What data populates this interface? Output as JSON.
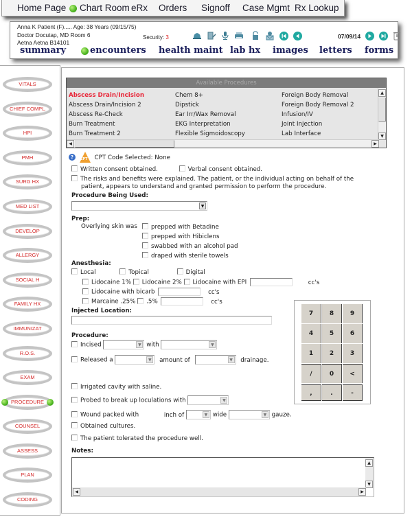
{
  "topnav": {
    "items": [
      "Home Page",
      "Chart Room",
      "eRx",
      "Orders",
      "Signoff",
      "Case Mgmt",
      "Rx Lookup"
    ]
  },
  "patient": {
    "line1": "Anna K Patient (F)..... Age: 38 Years (09/15/75)",
    "line2": "Doctor Docutap, MD  Room 6",
    "line3": "Aetna Aetna B14101",
    "security_label": "Security:",
    "security_value": "3",
    "date": "07/09/14"
  },
  "header_icons": [
    "hardhat-icon",
    "document-edit-icon",
    "microphone-icon",
    "printer-icon",
    "lock-icon",
    "mail-person-icon",
    "first-record-icon",
    "previous-record-icon",
    "next-record-icon",
    "last-record-icon",
    "trash-icon"
  ],
  "tabs": [
    "summary",
    "encounters",
    "health maint",
    "lab hx",
    "images",
    "letters",
    "forms"
  ],
  "sidebar": {
    "items": [
      "VITALS",
      "CHIEF COMPLAINT",
      "HPI",
      "PMH",
      "SURG HX",
      "MED LIST",
      "DEVELOP",
      "ALLERGY",
      "SOCIAL H",
      "FAMILY HX",
      "IMMUNIZAT",
      "R.O.S.",
      "EXAM",
      "PROCEDURE",
      "COUNSEL",
      "ASSESS",
      "PLAN",
      "CODING"
    ],
    "active": "PROCEDURE"
  },
  "procedures": {
    "title": "Available Procedures",
    "columns": [
      [
        "Abscess Drain/Incision",
        "Abscess Drain/Incision 2",
        "Abscess Re-Check",
        "Burn Treatment",
        "Burn Treatment 2"
      ],
      [
        "Chem 8+",
        "Dipstick",
        "Ear Irr/Wax Removal",
        "EKG Interpretation",
        "Flexible Sigmoidoscopy"
      ],
      [
        "Foreign Body Removal",
        "Foreign Body Removal 2",
        "Infusion/IV",
        "Joint Injection",
        "Lab Interface"
      ]
    ],
    "selected": "Abscess Drain/Incision"
  },
  "form": {
    "cpt_badge": "CPT",
    "cpt_selected": "CPT Code Selected: None",
    "written_consent": "Written consent obtained.",
    "verbal_consent": "Verbal consent obtained.",
    "risks_line1": "The risks and benefits were explained. The patient, or the individual acting on behalf of the",
    "risks_line2": "patient, appears to understand and granted permission to perform the procedure.",
    "procedure_used_label": "Procedure Being Used:",
    "procedure_used_value": "",
    "prep_label": "Prep:",
    "overlying": "Overlying skin was",
    "prep_options": [
      "prepped with Betadine",
      "prepped with Hibiclens",
      "swabbed with an alcohol pad",
      "draped with sterile towels"
    ],
    "anesthesia_label": "Anesthesia:",
    "anesthesia_types": [
      "Local",
      "Topical",
      "Digital"
    ],
    "lido1": "Lidocaine 1%",
    "lido2": "Lidocaine 2%",
    "lido_epi": "Lidocaine with EPI",
    "lido_bicarb": "Lidocaine with bicarb",
    "marcaine": "Marcaine .25%",
    "marcaine5": ".5%",
    "ccs": "cc's",
    "injected_label": "Injected Location:",
    "injected_value": "",
    "procedure_label": "Procedure:",
    "incised": "Incised",
    "with": "with",
    "released": "Released a",
    "amount_of": "amount of",
    "drainage": "drainage.",
    "irrigated": "Irrigated cavity with saline.",
    "probed": "Probed to break up loculations with",
    "wound_packed": "Wound packed with",
    "inch_of": "inch of",
    "wide": "wide",
    "gauze": "gauze.",
    "cultures": "Obtained cultures.",
    "tolerated": "The patient tolerated the procedure well.",
    "notes_label": "Notes:",
    "notes_value": ""
  },
  "keypad": {
    "keys": [
      "7",
      "8",
      "9",
      "4",
      "5",
      "6",
      "1",
      "2",
      "3",
      "/",
      "0",
      "<",
      ",",
      ".",
      "-"
    ]
  }
}
